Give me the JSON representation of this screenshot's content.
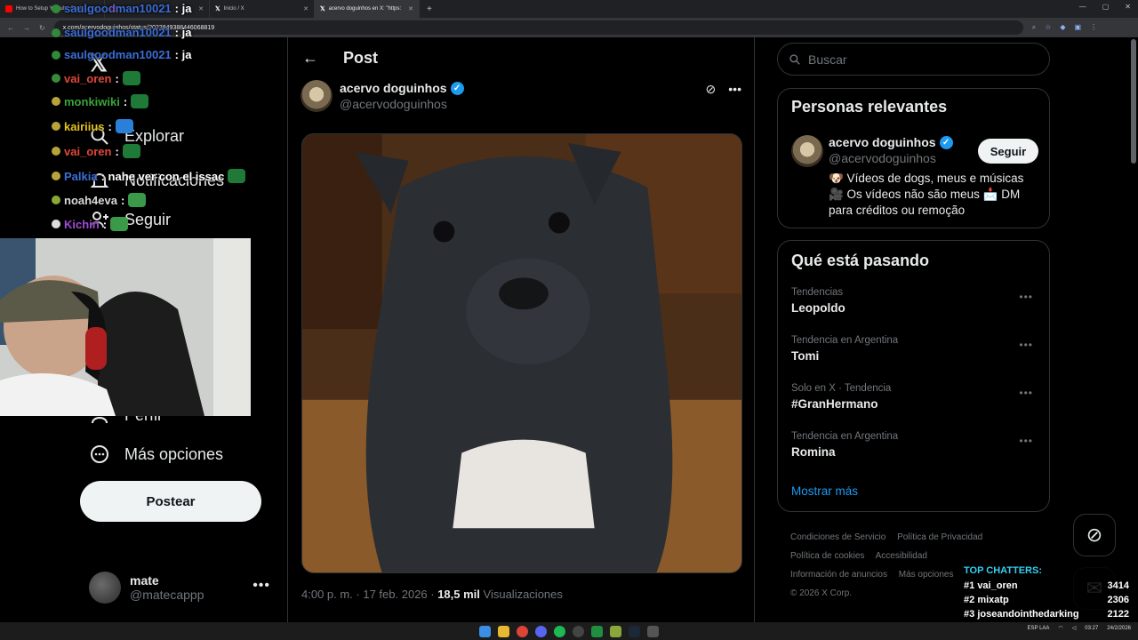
{
  "browser": {
    "tabs": [
      {
        "title": "How to Setup Youtube Chat",
        "color": "#ff0000"
      },
      {
        "title": "",
        "color": "#ff0000"
      },
      {
        "title": "Inicio / X",
        "color": "#ffffff"
      },
      {
        "title": "acervo doguinhos en X: \"https:",
        "color": "#ffffff"
      }
    ],
    "url": "x.com/acervodoguinhos/status/2023849388446068819"
  },
  "sidebar": {
    "nav": [
      {
        "label": "Explorar",
        "icon": "search-icon"
      },
      {
        "label": "Notificaciones",
        "icon": "bell-icon"
      },
      {
        "label": "Seguir",
        "icon": "follow-icon"
      },
      {
        "label": "Perfil",
        "icon": "profile-icon"
      },
      {
        "label": "Más opciones",
        "icon": "more-options-icon"
      }
    ],
    "post_button": "Postear",
    "account": {
      "name": "mate",
      "handle": "@matecappp"
    }
  },
  "main": {
    "title": "Post",
    "author": {
      "name": "acervo doguinhos",
      "handle": "@acervodoguinhos"
    },
    "timestamp": "4:00 p. m. · 17 feb. 2026 · ",
    "views_count": "18,5 mil",
    "views_label": " Visualizaciones"
  },
  "right": {
    "search_placeholder": "Buscar",
    "people": {
      "title": "Personas relevantes",
      "name": "acervo doguinhos",
      "handle": "@acervodoguinhos",
      "follow": "Seguir",
      "bio": "🐶 Vídeos de dogs, meus e músicas 🎥 Os vídeos não são meus 📩 DM para créditos ou remoção"
    },
    "trends": {
      "title": "Qué está pasando",
      "items": [
        {
          "category": "Tendencias",
          "name": "Leopoldo"
        },
        {
          "category": "Tendencia en Argentina",
          "name": "Tomi"
        },
        {
          "category": "Solo en X · Tendencia",
          "name": "#GranHermano"
        },
        {
          "category": "Tendencia en Argentina",
          "name": "Romina"
        }
      ],
      "show_more": "Mostrar más"
    },
    "footer": [
      "Condiciones de Servicio",
      "Política de Privacidad",
      "Política de cookies",
      "Accesibilidad",
      "Información de anuncios",
      "Más opciones",
      "© 2026 X Corp."
    ]
  },
  "chat": [
    {
      "user": "saulgoodman10021",
      "msg": ": ja"
    },
    {
      "user": "saulgoodman10021",
      "msg": ": ja"
    },
    {
      "user": "saulgoodman10021",
      "msg": ": ja"
    },
    {
      "user": "vai_oren",
      "msg": ":",
      "user_color": "#e0473a"
    },
    {
      "user": "monkiwiki",
      "msg": ":",
      "user_color": "#3aa33a"
    },
    {
      "user": "kairiius",
      "msg": ":",
      "user_color": "#e3c21d"
    },
    {
      "user": "vai_oren",
      "msg": ":",
      "user_color": "#e0473a"
    },
    {
      "user": "Palkia",
      "msg": ": nahe ver con el issac",
      "user_color": "#3b6ed8"
    },
    {
      "user": "noah4eva",
      "msg": ":",
      "user_color": "#d8d8d8"
    },
    {
      "user": "Kichin",
      "msg": ":",
      "user_color": "#a14bd8"
    }
  ],
  "top_chatters": {
    "title": "TOP CHATTERS:",
    "rows": [
      {
        "rank": "#1",
        "name": "vai_oren",
        "count": "3414"
      },
      {
        "rank": "#2",
        "name": "mixatp",
        "count": "2306"
      },
      {
        "rank": "#3",
        "name": "joseandointhedarking",
        "count": "2122"
      }
    ]
  },
  "tray": {
    "lang": "ESP LAA",
    "time": "03:27",
    "date": "24/2/2026"
  },
  "colors": {
    "accent": "#1d9bf0",
    "background": "#000000",
    "border": "#2f3336"
  }
}
